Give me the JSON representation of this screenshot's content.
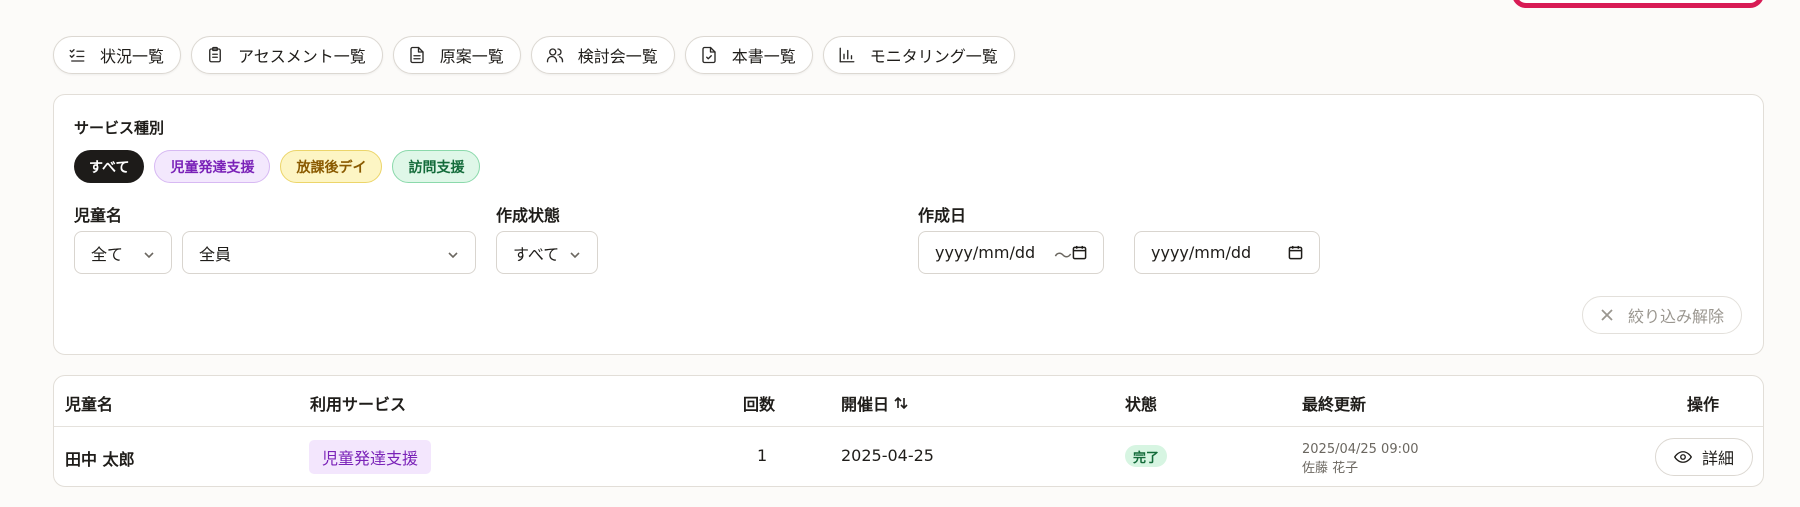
{
  "tabs": [
    {
      "label": "状況一覧",
      "icon": "list-check-icon"
    },
    {
      "label": "アセスメント一覧",
      "icon": "clipboard-icon"
    },
    {
      "label": "原案一覧",
      "icon": "document-icon"
    },
    {
      "label": "検討会一覧",
      "icon": "users-icon"
    },
    {
      "label": "本書一覧",
      "icon": "file-check-icon"
    },
    {
      "label": "モニタリング一覧",
      "icon": "bar-chart-icon"
    }
  ],
  "filters": {
    "service_type_label": "サービス種別",
    "service_chips": [
      "すべて",
      "児童発達支援",
      "放課後デイ",
      "訪問支援"
    ],
    "child_name_label": "児童名",
    "child_scope_value": "全て",
    "child_select_value": "全員",
    "status_label": "作成状態",
    "status_value": "すべて",
    "date_label": "作成日",
    "date_from_placeholder": "yyyy/mm/dd",
    "date_to_placeholder": "yyyy/mm/dd",
    "range_separator": "～",
    "clear_label": "絞り込み解除"
  },
  "table": {
    "headers": {
      "child_name": "児童名",
      "service": "利用サービス",
      "count": "回数",
      "date": "開催日",
      "status": "状態",
      "updated": "最終更新",
      "actions": "操作"
    },
    "rows": [
      {
        "child_name": "田中 太郎",
        "service": "児童発達支援",
        "count": "1",
        "date": "2025-04-25",
        "status": "完了",
        "updated_at": "2025/04/25 09:00",
        "updated_by": "佐藤 花子",
        "action_label": "詳細"
      }
    ]
  },
  "colors": {
    "accent_outline": "#d81b55",
    "chip_active_bg": "#1d1b19",
    "service_purple": "#7a22b8",
    "status_green": "#136b3a"
  }
}
